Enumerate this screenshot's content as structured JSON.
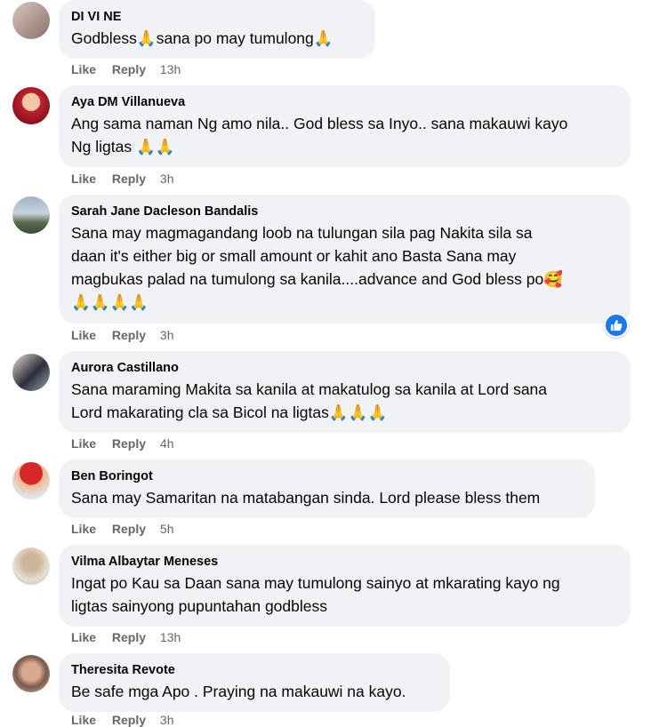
{
  "action_labels": {
    "like": "Like",
    "reply": "Reply"
  },
  "comments": [
    {
      "author": "DI VI NE",
      "lines": [
        "Godbless🙏sana po may tumulong🙏"
      ],
      "time": "13h"
    },
    {
      "author": "Aya DM Villanueva",
      "lines": [
        "Ang sama naman Ng amo nila.. God bless sa Inyo.. sana makauwi kayo",
        "Ng ligtas 🙏🙏"
      ],
      "time": "3h"
    },
    {
      "author": "Sarah Jane Dacleson Bandalis",
      "lines": [
        "Sana may magmagandang loob na tulungan sila pag Nakita sila sa",
        "daan it's either big or small amount or kahit ano Basta Sana may",
        "magbukas palad na tumulong sa kanila....advance and God bless po🥰",
        "🙏🙏🙏🙏"
      ],
      "time": "3h",
      "reaction": "like"
    },
    {
      "author": "Aurora Castillano",
      "lines": [
        "Sana maraming Makita sa kanila at makatulog sa kanila at Lord sana",
        "Lord makarating cla sa Bicol na ligtas🙏🙏🙏"
      ],
      "time": "4h"
    },
    {
      "author": "Ben Boringot",
      "lines": [
        "Sana may Samaritan na matabangan sinda. Lord please bless them"
      ],
      "time": "5h"
    },
    {
      "author": "Vilma Albaytar Meneses",
      "lines": [
        "Ingat po Kau sa Daan sana may tumulong sainyo at mkarating kayo ng",
        "ligtas sainyong pupuntahan godbless"
      ],
      "time": "13h"
    },
    {
      "author": "Theresita Revote",
      "lines": [
        "Be safe mga Apo . Praying na makauwi na kayo."
      ],
      "time": "3h"
    }
  ],
  "colors": {
    "bubble": "#f0f2f5",
    "meta": "#65676b",
    "like_blue": "#1877f2"
  }
}
